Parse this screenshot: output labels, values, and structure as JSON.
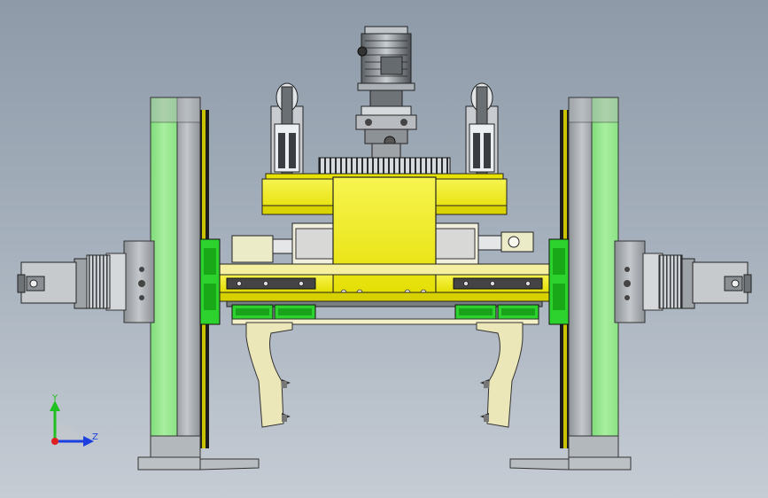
{
  "viewport": {
    "background_top": "#8e9aa8",
    "background_bottom": "#c6ccd4"
  },
  "triad": {
    "y_label": "Y",
    "z_label": "Z",
    "y_color": "#1fc01f",
    "z_color": "#1d3fe0",
    "x_color": "#e01f1f"
  },
  "colors": {
    "frame_green": "#9ee89a",
    "steel_gray": "#9ea3a8",
    "yellow": "#f2ee12",
    "yellow_dark": "#c9c300",
    "rail_green": "#2ed22e",
    "pale_yellow": "#ece7b8",
    "dark": "#1e1e1e"
  }
}
